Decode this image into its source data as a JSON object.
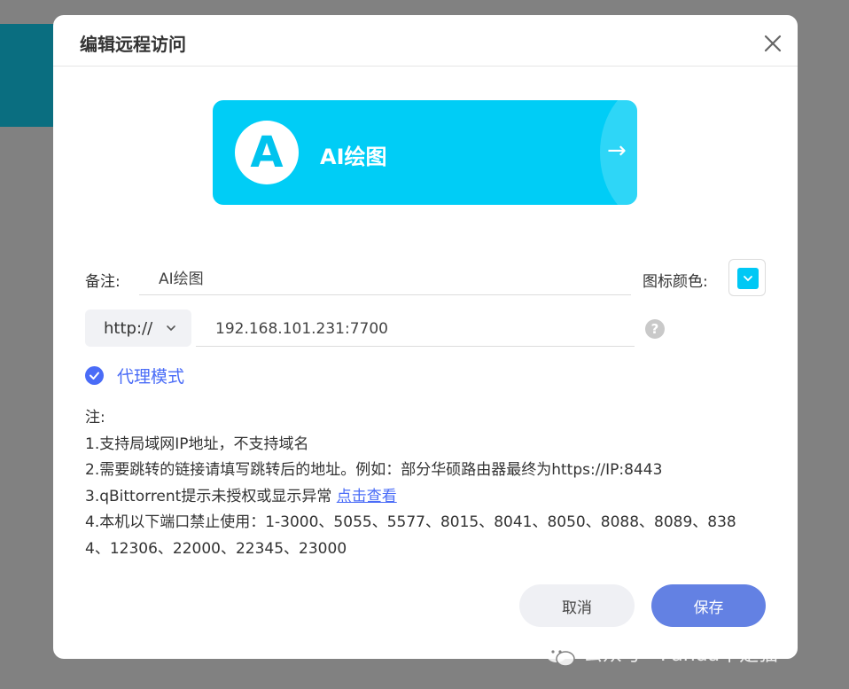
{
  "dialog": {
    "title": "编辑远程访问"
  },
  "preview": {
    "avatar_letter": "A",
    "title": "AI绘图",
    "arrow": "→"
  },
  "form": {
    "note_label": "备注:",
    "note_value": "AI绘图",
    "icon_color_label": "图标颜色:",
    "icon_color": "#00c8f5",
    "protocol": "http://",
    "address_value": "192.168.101.231:7700",
    "help_icon": "?",
    "proxy_mode_label": "代理模式",
    "proxy_mode_checked": true
  },
  "notes": {
    "heading": "注:",
    "line1": "1.支持局域网IP地址，不支持域名",
    "line2": "2.需要跳转的链接请填写跳转后的地址。例如：部分华硕路由器最终为https://IP:8443",
    "line3_prefix": "3.qBittorrent提示未授权或显示异常 ",
    "line3_link": "点击查看",
    "line4a": "4.本机以下端口禁止使用：1-3000、5055、5577、8015、8041、8050、8088、8089、838",
    "line4b": "4、12306、22000、22345、23000"
  },
  "buttons": {
    "cancel": "取消",
    "save": "保存"
  },
  "watermark": {
    "text": "公众号 · Panda不是猫"
  },
  "colors": {
    "accent": "#4a6cf7",
    "save_button": "#6381e3",
    "preview_card": "#00cdf6"
  }
}
